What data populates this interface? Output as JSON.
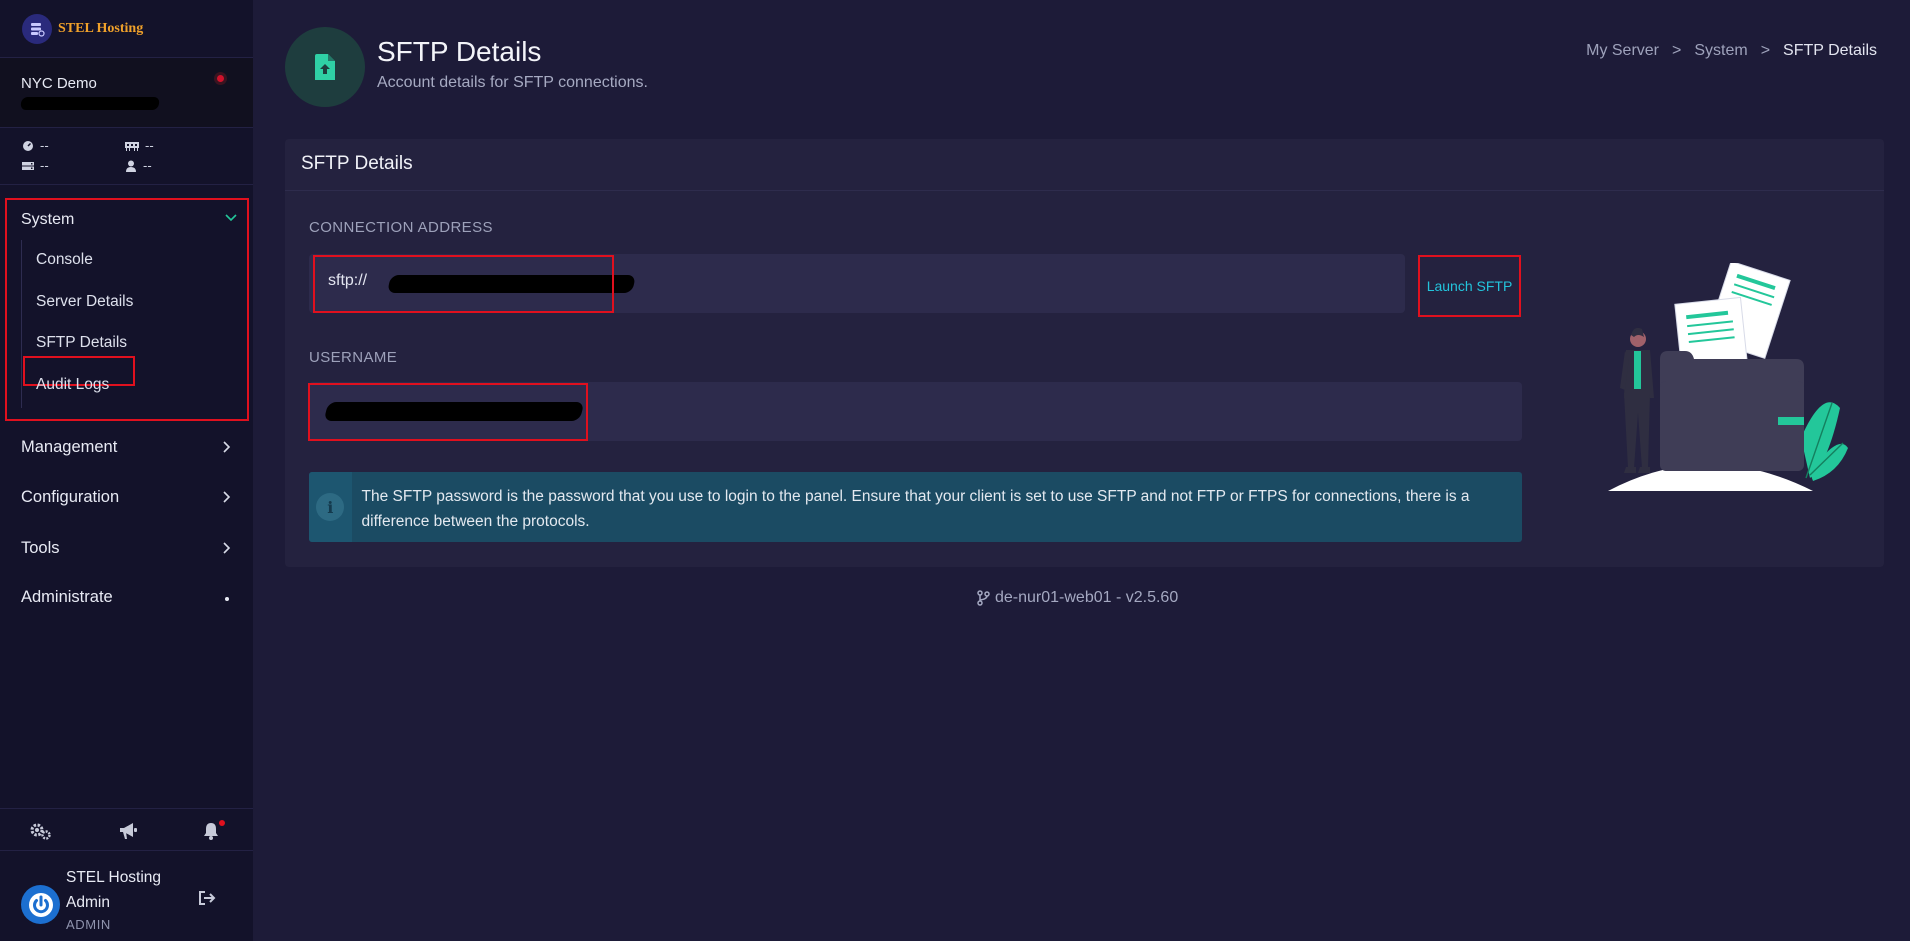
{
  "brand": {
    "name": "STEL Hosting"
  },
  "server": {
    "name": "NYC Demo",
    "stats": {
      "cpu": "--",
      "memory": "--",
      "disk": "--",
      "players": "--"
    }
  },
  "sidebar": {
    "system": {
      "label": "System",
      "items": [
        {
          "label": "Console"
        },
        {
          "label": "Server Details"
        },
        {
          "label": "SFTP Details"
        },
        {
          "label": "Audit Logs"
        }
      ]
    },
    "nav": [
      {
        "label": "Management"
      },
      {
        "label": "Configuration"
      },
      {
        "label": "Tools"
      },
      {
        "label": "Administrate"
      }
    ]
  },
  "user": {
    "name": "STEL Hosting Admin",
    "role": "ADMIN"
  },
  "header": {
    "title": "SFTP Details",
    "subtitle": "Account details for SFTP connections."
  },
  "breadcrumb": [
    "My Server",
    "System",
    "SFTP Details"
  ],
  "breadcrumb_sep": ">",
  "card": {
    "title": "SFTP Details",
    "connection_label": "CONNECTION ADDRESS",
    "connection_value": "sftp://",
    "launch_button": "Launch SFTP",
    "username_label": "USERNAME",
    "alert_icon": "i",
    "alert": "The SFTP password is the password that you use to login to the panel. Ensure that your client is set to use SFTP and not FTP or FTPS for connections, there is a difference between the protocols."
  },
  "footer": {
    "version": "de-nur01-web01 - v2.5.60"
  },
  "colors": {
    "accent": "#23c4dc",
    "highlight": "#e0101e",
    "background": "#1d1b38",
    "sidebar": "#13122a",
    "card": "#24223f",
    "info": "#1b4b63",
    "illustration_green": "#23c79a"
  }
}
